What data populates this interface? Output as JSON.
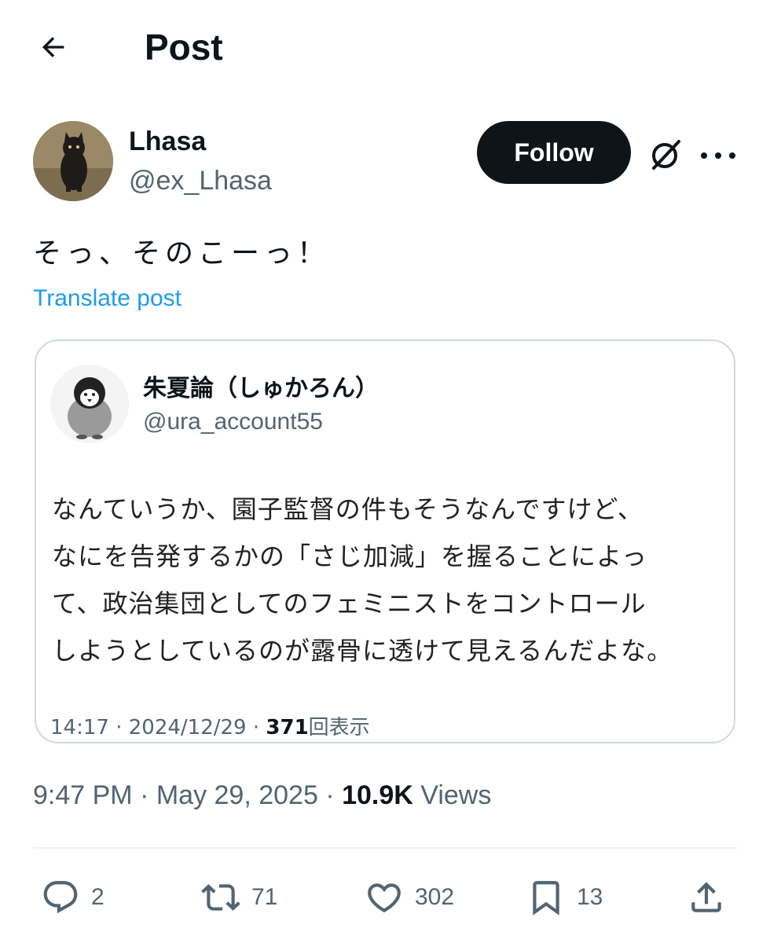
{
  "header": {
    "title": "Post"
  },
  "author": {
    "name": "Lhasa",
    "handle": "@ex_Lhasa",
    "follow_label": "Follow"
  },
  "post": {
    "text": "そっ、そのこーっ！",
    "translate_label": "Translate post"
  },
  "quote": {
    "name": "朱夏論（しゅかろん）",
    "handle": "@ura_account55",
    "lines": [
      "なんていうか、園子監督の件もそうなんですけど、",
      "なにを告発するかの「さじ加減」を握ることによっ",
      "て、政治集団としてのフェミニストをコントロール",
      "しようとしているのが露骨に透けて見えるんだよな。"
    ],
    "time": "14:17",
    "date": "2024/12/29",
    "views": "371",
    "views_label": "回表示"
  },
  "meta": {
    "time": "9:47 PM",
    "date": "May 29, 2025",
    "views": "10.9K",
    "views_label": "Views"
  },
  "actions": {
    "replies": "2",
    "reposts": "71",
    "likes": "302",
    "bookmarks": "13"
  },
  "icons": {
    "back": "arrow-left-icon",
    "grok": "grok-icon",
    "more": "more-horizontal-icon",
    "reply": "reply-icon",
    "repost": "repost-icon",
    "like": "heart-icon",
    "bookmark": "bookmark-icon",
    "share": "share-icon"
  },
  "colors": {
    "link": "#1d9bf0",
    "text": "#0f1419",
    "muted": "#536471",
    "border": "#cfd9de"
  }
}
